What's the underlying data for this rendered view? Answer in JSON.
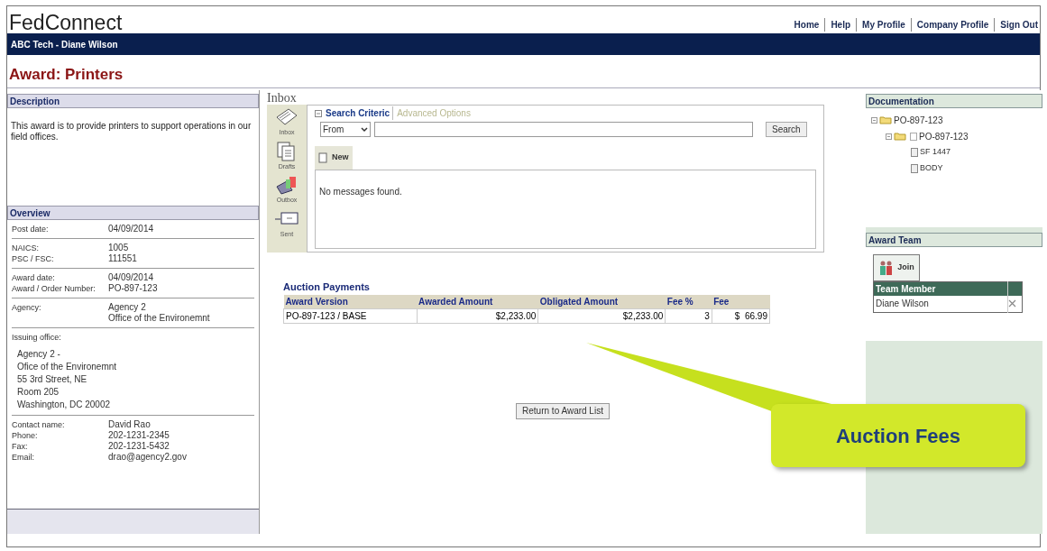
{
  "header": {
    "logo": "FedConnect",
    "nav_links": [
      "Home",
      "Help",
      "My Profile",
      "Company Profile",
      "Sign Out"
    ],
    "user_bar": "ABC Tech - Diane Wilson"
  },
  "page_title": "Award: Printers",
  "description": {
    "heading": "Description",
    "text": "This award is to provide printers to support operations in our field offices."
  },
  "overview": {
    "heading": "Overview",
    "sections": [
      {
        "kind": "rows",
        "rows": [
          {
            "label": "Post date:",
            "lines": [
              "04/09/2014"
            ]
          }
        ]
      },
      {
        "kind": "rows",
        "rows": [
          {
            "label": "NAICS:",
            "lines": [
              "1005"
            ]
          },
          {
            "label": "PSC / FSC:",
            "lines": [
              "111551"
            ]
          }
        ]
      },
      {
        "kind": "rows",
        "rows": [
          {
            "label": "Award date:",
            "lines": [
              "04/09/2014"
            ]
          },
          {
            "label": "Award / Order Number:",
            "lines": [
              "PO-897-123"
            ]
          }
        ]
      },
      {
        "kind": "rows",
        "rows": [
          {
            "label": "Agency:",
            "lines": [
              "Agency 2",
              "Office of the Environemnt"
            ]
          }
        ]
      },
      {
        "kind": "address",
        "label": "Issuing office:",
        "lines": [
          "Agency 2 -",
          "Ofice of the Environemnt",
          "55 3rd Street, NE",
          "Room 205",
          "Washington, DC 20002"
        ]
      },
      {
        "kind": "rows",
        "rows": [
          {
            "label": "Contact name:",
            "lines": [
              "David Rao"
            ]
          },
          {
            "label": "Phone:",
            "lines": [
              "202-1231-2345"
            ]
          },
          {
            "label": "Fax:",
            "lines": [
              "202-1231-5432"
            ]
          },
          {
            "label": "Email:",
            "lines": [
              "drao@agency2.gov"
            ]
          }
        ]
      }
    ]
  },
  "inbox": {
    "title": "Inbox",
    "folders": [
      {
        "kind": "inbox",
        "label": "Inbox"
      },
      {
        "kind": "drafts",
        "label": "Drafts"
      },
      {
        "kind": "outbox",
        "label": "Outbox"
      },
      {
        "kind": "sent",
        "label": "Sent"
      }
    ],
    "search_criteria": "Search Criteric",
    "advanced_options": "Advanced Options",
    "field_select": "From",
    "search_button": "Search",
    "new_button": "New",
    "empty_message": "No messages found."
  },
  "auction_payments": {
    "title": "Auction Payments",
    "columns": [
      "Award Version",
      "Awarded Amount",
      "Obligated Amount",
      "Fee %",
      "Fee"
    ],
    "rows": [
      [
        "PO-897-123 / BASE",
        "$2,233.00",
        "$2,233.00",
        "3",
        "$  66.99"
      ]
    ]
  },
  "return_button": "Return to Award List",
  "documentation": {
    "heading": "Documentation",
    "tree": [
      {
        "kind": "folder",
        "label": "PO-897-123",
        "children": [
          {
            "kind": "folder",
            "label": "PO-897-123",
            "checked": false,
            "children": [
              {
                "kind": "doc",
                "label": "SF 1447"
              },
              {
                "kind": "doc",
                "label": "BODY"
              }
            ]
          }
        ]
      }
    ]
  },
  "award_team": {
    "heading": "Award Team",
    "join_button": "Join",
    "column": "Team Member",
    "members": [
      "Diane Wilson"
    ]
  },
  "callout": "Auction Fees"
}
